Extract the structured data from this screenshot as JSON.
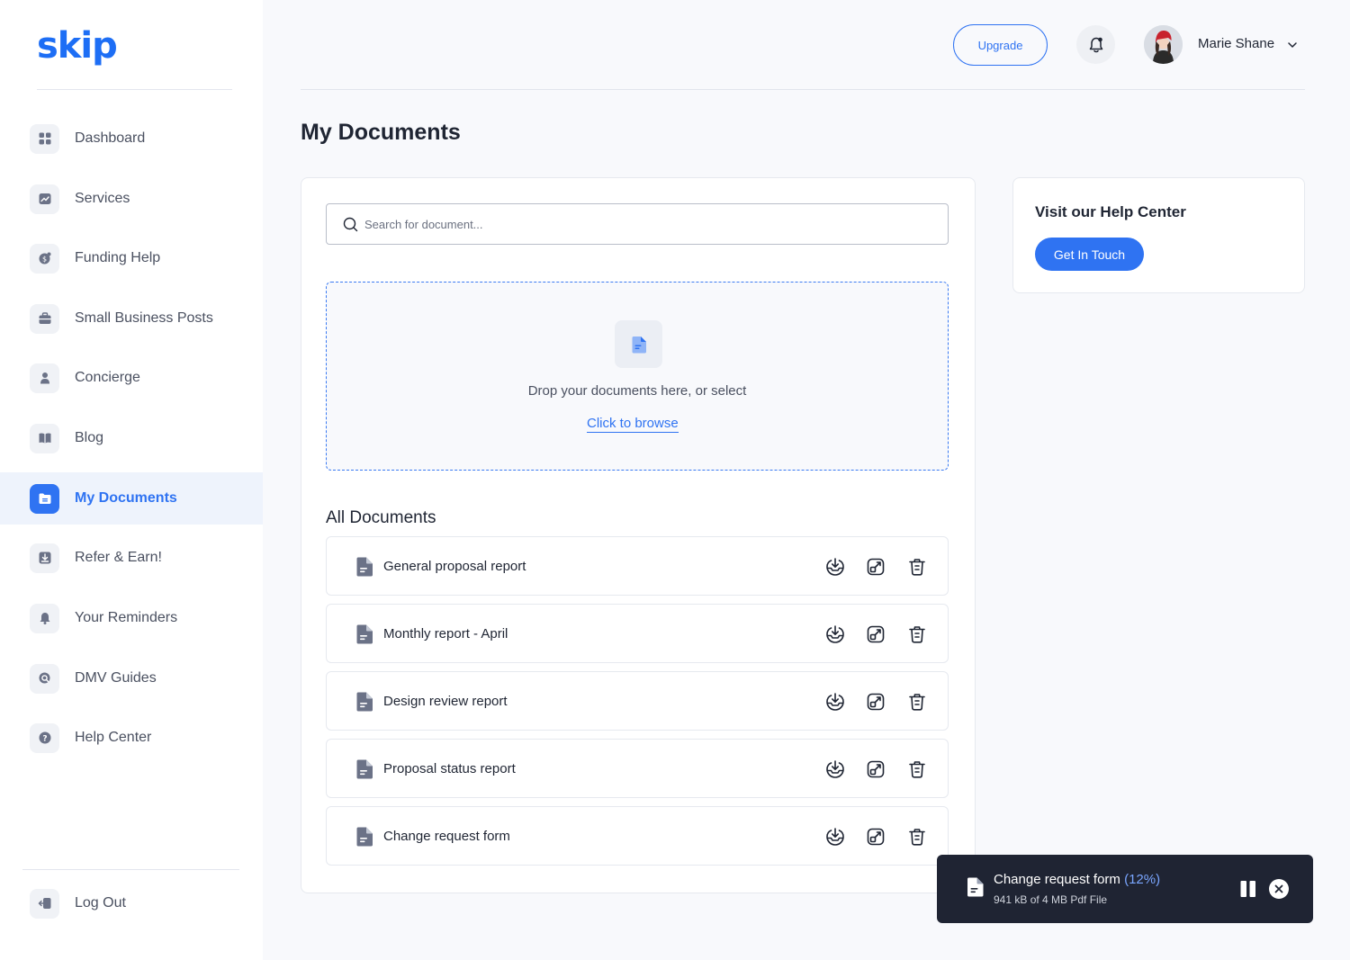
{
  "app": {
    "logo_text": "skip"
  },
  "sidebar": {
    "items": [
      {
        "label": "Dashboard",
        "icon": "grid-icon"
      },
      {
        "label": "Services",
        "icon": "chart-icon"
      },
      {
        "label": "Funding Help",
        "icon": "coin-icon"
      },
      {
        "label": "Small Business Posts",
        "icon": "briefcase-icon"
      },
      {
        "label": "Concierge",
        "icon": "person-icon"
      },
      {
        "label": "Blog",
        "icon": "book-icon"
      },
      {
        "label": "My Documents",
        "icon": "folder-icon",
        "active": true
      },
      {
        "label": "Refer & Earn!",
        "icon": "download-icon"
      },
      {
        "label": "Your Reminders",
        "icon": "bell-icon"
      },
      {
        "label": "DMV Guides",
        "icon": "search-icon"
      },
      {
        "label": "Help Center",
        "icon": "question-icon"
      }
    ],
    "logout_label": "Log Out"
  },
  "header": {
    "upgrade_label": "Upgrade",
    "user_name": "Marie Shane"
  },
  "main": {
    "title": "My Documents",
    "search_placeholder": "Search for document...",
    "dropzone": {
      "text": "Drop your documents here, or select",
      "link": "Click to browse"
    },
    "section_title": "All Documents",
    "documents": [
      {
        "name": "General proposal report"
      },
      {
        "name": "Monthly report - April"
      },
      {
        "name": "Design review report"
      },
      {
        "name": "Proposal status report"
      },
      {
        "name": "Change request form"
      }
    ]
  },
  "help": {
    "title": "Visit our Help Center",
    "button_label": "Get In Touch"
  },
  "upload_toast": {
    "file_name": "Change request form",
    "percent": "(12%)",
    "progress": 0.12,
    "detail": "941 kB of 4 MB Pdf File"
  },
  "colors": {
    "accent": "#2f73f2",
    "logo": "#1d6ef5",
    "toast_bg": "#1f2433",
    "icon_gray": "#6b7287"
  }
}
